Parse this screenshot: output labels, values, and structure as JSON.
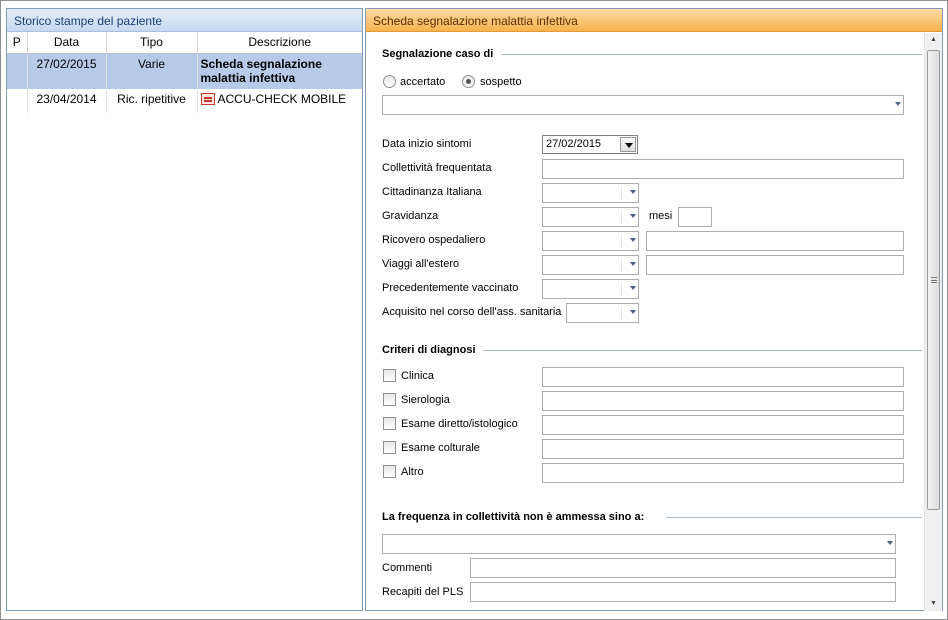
{
  "left_panel": {
    "title": "Storico stampe del paziente",
    "columns": {
      "p": "P",
      "data": "Data",
      "tipo": "Tipo",
      "descrizione": "Descrizione"
    },
    "rows": [
      {
        "data": "27/02/2015",
        "tipo": "Varie",
        "descrizione": "Scheda segnalazione malattia infettiva",
        "selected": true,
        "icon": ""
      },
      {
        "data": "23/04/2014",
        "tipo": "Ric. ripetitive",
        "descrizione": "ACCU-CHECK MOBILE",
        "selected": false,
        "icon": "pdf-icon"
      }
    ]
  },
  "right_panel": {
    "title": "Scheda segnalazione malattia infettiva",
    "section_segnalazione": "Segnalazione caso di",
    "radio_accertato": "accertato",
    "radio_sospetto": "sospetto",
    "selected_radio": "sospetto",
    "fields": {
      "data_inizio_sintomi": "Data inizio sintomi",
      "data_inizio_sintomi_value": "27/02/2015",
      "collettivita": "Collettività frequentata",
      "cittadinanza": "Cittadinanza Italiana",
      "gravidanza": "Gravidanza",
      "mesi": "mesi",
      "ricovero": "Ricovero ospedaliero",
      "viaggi": "Viaggi all'estero",
      "vaccinato": "Precedentemente vaccinato",
      "acquisito": "Acquisito nel corso dell'ass. sanitaria"
    },
    "section_criteri": "Criteri di diagnosi",
    "criteri": {
      "clinica": "Clinica",
      "sierologia": "Sierologia",
      "esame_diretto": "Esame diretto/istologico",
      "esame_colturale": "Esame colturale",
      "altro": "Altro"
    },
    "section_frequenza": "La frequenza in collettività non è ammessa sino a:",
    "commenti": "Commenti",
    "recapiti": "Recapiti del PLS"
  }
}
